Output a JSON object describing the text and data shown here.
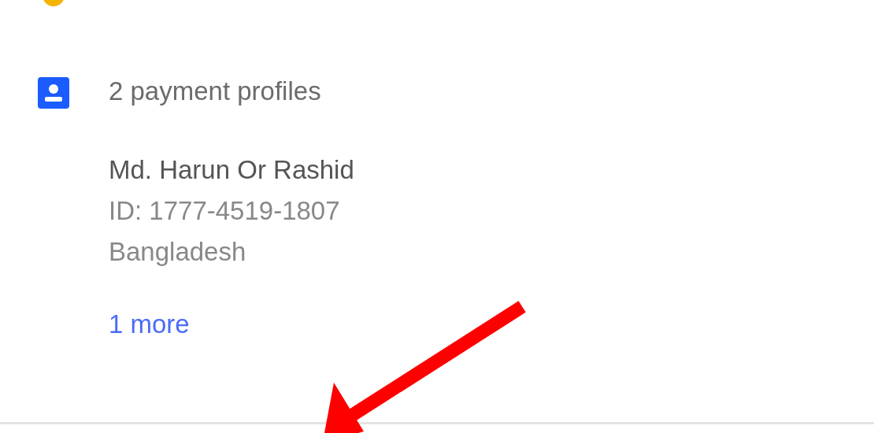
{
  "payment_section": {
    "title": "2 payment profiles",
    "profile": {
      "name": "Md. Harun Or Rashid",
      "id": "ID: 1777-4519-1807",
      "country": "Bangladesh"
    },
    "more_link": "1 more"
  }
}
